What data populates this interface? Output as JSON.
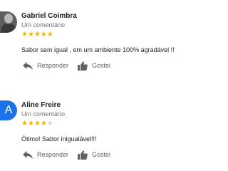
{
  "reviews": [
    {
      "author": "Gabriel Coimbra",
      "subtitle": "Um comentário",
      "rating": 5,
      "rating_max": 5,
      "text": "Sabor sem igual , em um ambiente 100% agradável !!",
      "avatar": "photo",
      "reply_label": "Responder",
      "like_label": "Gostei"
    },
    {
      "author": "Aline Freire",
      "subtitle": "Um comentário",
      "rating": 4,
      "rating_max": 5,
      "text": "Ótimo! Sabor inigualável!!!",
      "avatar_letter": "A",
      "avatar_color": "#1a73e8",
      "reply_label": "Responder",
      "like_label": "Gostei"
    }
  ],
  "colors": {
    "star_on": "#f4b400",
    "star_off": "#d5d5d5",
    "secondary_text": "#70757a"
  },
  "icons": [
    "reply-icon",
    "thumbs-up-icon",
    "star-icon"
  ]
}
